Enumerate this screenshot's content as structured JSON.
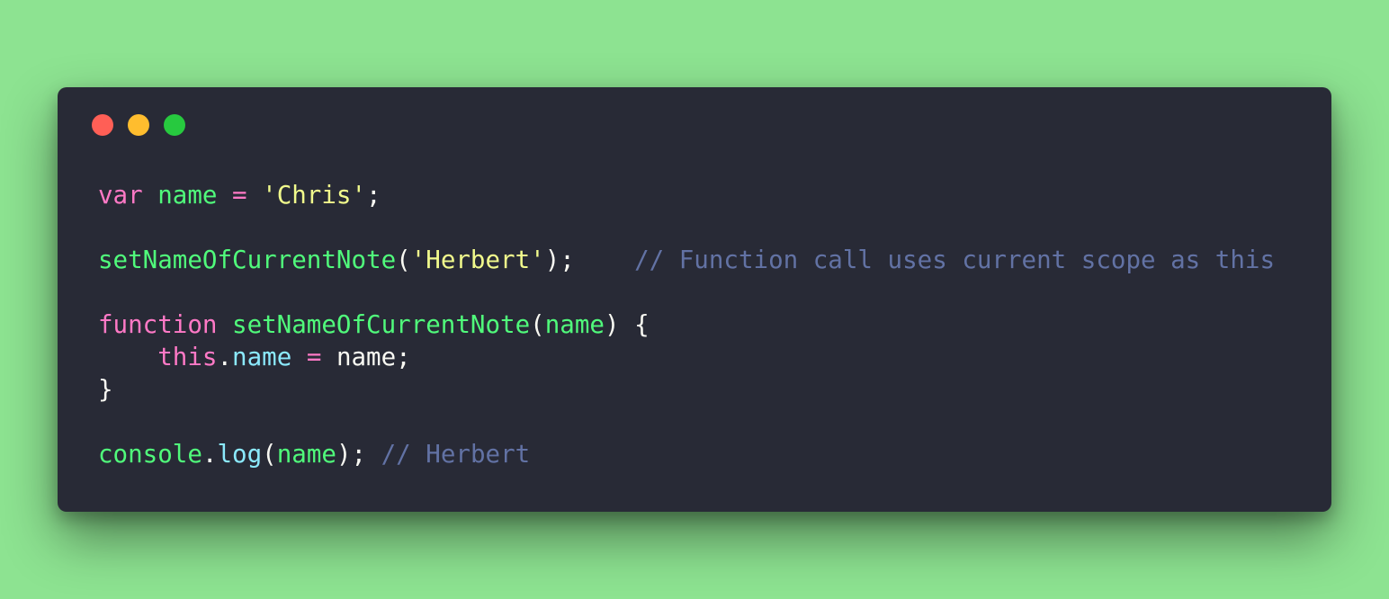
{
  "window": {
    "traffic_lights": [
      {
        "name": "close",
        "color": "#ff5f56"
      },
      {
        "name": "minimize",
        "color": "#ffbd2e"
      },
      {
        "name": "maximize",
        "color": "#27c93f"
      }
    ]
  },
  "theme": {
    "background": "#8de391",
    "editor_bg": "#282a36",
    "keyword": "#ff79c6",
    "function": "#50fa7b",
    "string": "#f1fa8c",
    "property": "#8be9fd",
    "comment": "#6272a4",
    "plain": "#f8f8f2"
  },
  "code": {
    "line1": {
      "kw": "var",
      "sp1": " ",
      "ident": "name",
      "op": " = ",
      "str": "'Chris'",
      "semi": ";"
    },
    "line3": {
      "fn": "setNameOfCurrentNote",
      "open": "(",
      "str": "'Herbert'",
      "close": ");",
      "pad": "    ",
      "comment": "// Function call uses current scope as this"
    },
    "line5": {
      "kw": "function",
      "sp": " ",
      "fn": "setNameOfCurrentNote",
      "open": "(",
      "param": "name",
      "close": ") {"
    },
    "line6": {
      "indent": "    ",
      "kw": "this",
      "dot": ".",
      "prop": "name",
      "op": " = ",
      "value": "name;"
    },
    "line7": {
      "brace": "}"
    },
    "line9": {
      "obj": "console",
      "dot": ".",
      "method": "log",
      "open": "(",
      "arg": "name",
      "close": ");",
      "sp": " ",
      "comment": "// Herbert"
    }
  }
}
